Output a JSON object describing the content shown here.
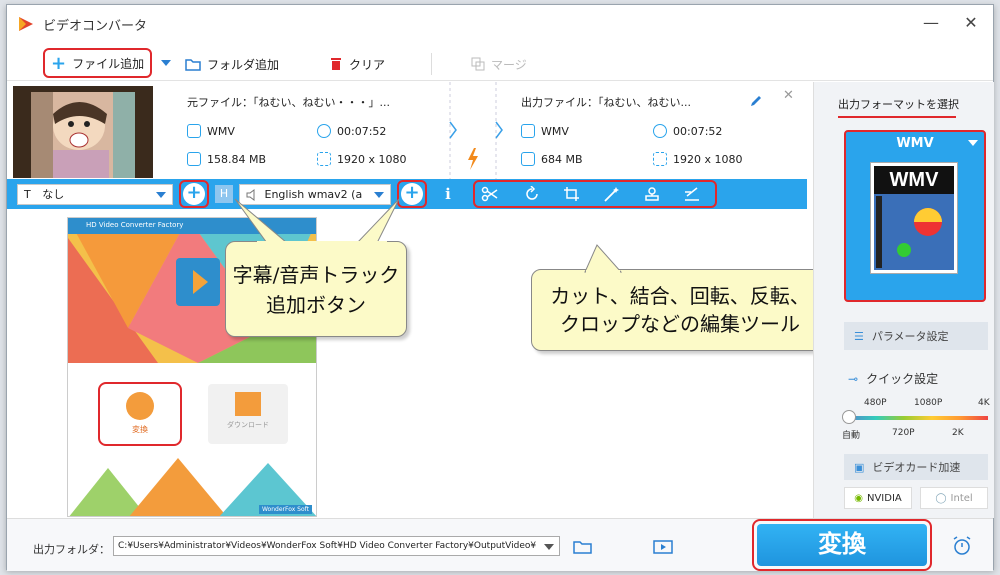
{
  "app": {
    "title": "ビデオコンバータ",
    "window_controls": {
      "minimize": "—",
      "close": "✕"
    }
  },
  "toolbar": {
    "add_file": "ファイル追加",
    "add_folder": "フォルダ追加",
    "clear": "クリア",
    "merge": "マージ"
  },
  "task": {
    "source_label": "元ファイル：「ねむい、ねむい・・・」...",
    "source_format": "WMV",
    "source_duration": "00:07:52",
    "source_size": "158.84 MB",
    "source_resolution": "1920 x 1080",
    "output_label": "出力ファイル：「ねむい、ねむい...",
    "output_format": "WMV",
    "output_duration": "00:07:52",
    "output_size": "684 MB",
    "output_resolution": "1920 x 1080"
  },
  "editbar": {
    "subtitle_value": "なし",
    "subtitle_prefix": "T",
    "audio_value": "English wmav2 (a",
    "info_glyph": "ℹ"
  },
  "sidebar": {
    "format_tab": "出力フォーマットを選択",
    "format_name": "WMV",
    "format_image_label": "WMV",
    "parameter_button": "パラメータ設定",
    "quick_title": "クイック設定",
    "quick_top_ticks": [
      "480P",
      "1080P",
      "4K"
    ],
    "quick_bottom_ticks": [
      "自動",
      "720P",
      "2K"
    ],
    "gpu_button": "ビデオカード加速",
    "vendor_nvidia": "NVIDIA",
    "vendor_intel": "Intel"
  },
  "footer": {
    "output_folder_label": "出力フォルダ：",
    "output_path": "C:¥Users¥Administrator¥Videos¥WonderFox Soft¥HD Video Converter Factory¥OutputVideo¥",
    "convert_button": "変換"
  },
  "preview": {
    "app_title": "HD Video Converter Factory",
    "convert_label": "変換",
    "download_label": "ダウンロード",
    "brand": "WonderFox Soft"
  },
  "callouts": {
    "subtitle_audio": "字幕/音声トラック追加ボタン",
    "edit_tools": "カット、結合、回転、反転、クロップなどの編集ツール"
  },
  "colors": {
    "accent": "#2aa4ec",
    "highlight": "#e0282c",
    "callout_bg": "#fcfac8"
  }
}
